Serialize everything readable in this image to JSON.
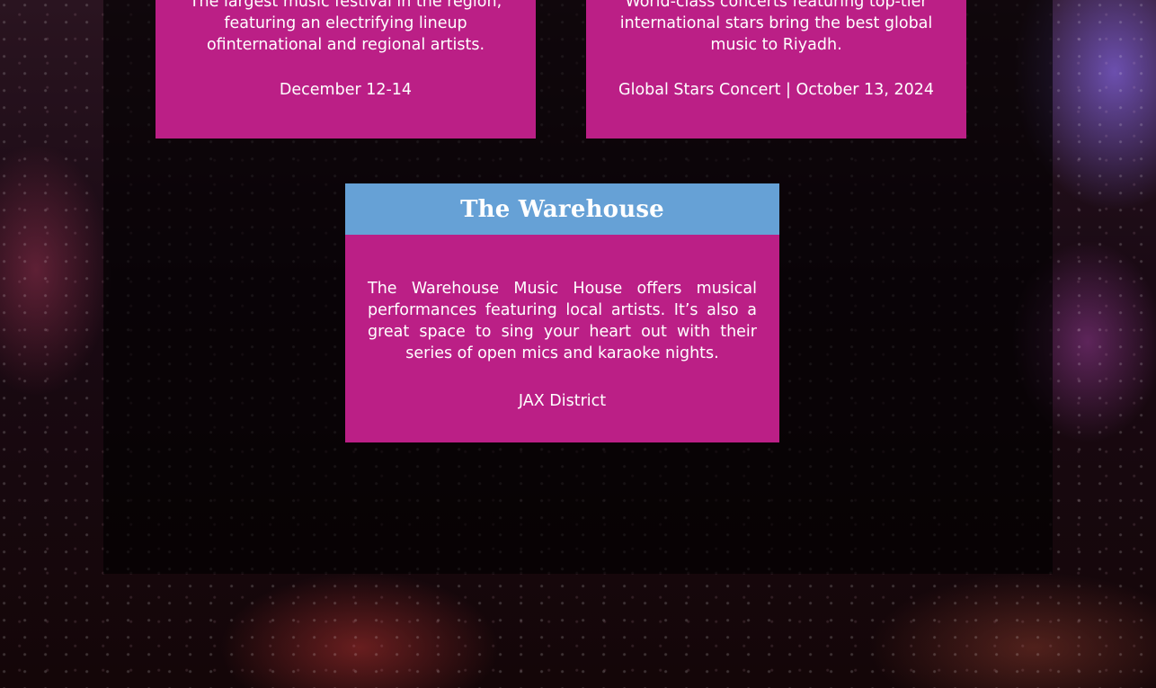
{
  "cards": [
    {
      "description": "The largest music festival in the region, featuring an electrifying lineup ofinternational and regional artists.",
      "meta": "December 12-14"
    },
    {
      "description": "World-class concerts featuring top-tier international stars bring the best global music to Riyadh.",
      "meta": "Global Stars Concert | October 13, 2024"
    },
    {
      "title": "The Warehouse",
      "description": "The Warehouse Music House offers musical performances featuring local artists. It’s also a great space to sing your heart out with their series of open mics and karaoke nights.",
      "meta": "JAX District"
    }
  ],
  "colors": {
    "card_background": "#bb1f86",
    "header_background": "#66a1d6",
    "text": "#ffffff"
  }
}
